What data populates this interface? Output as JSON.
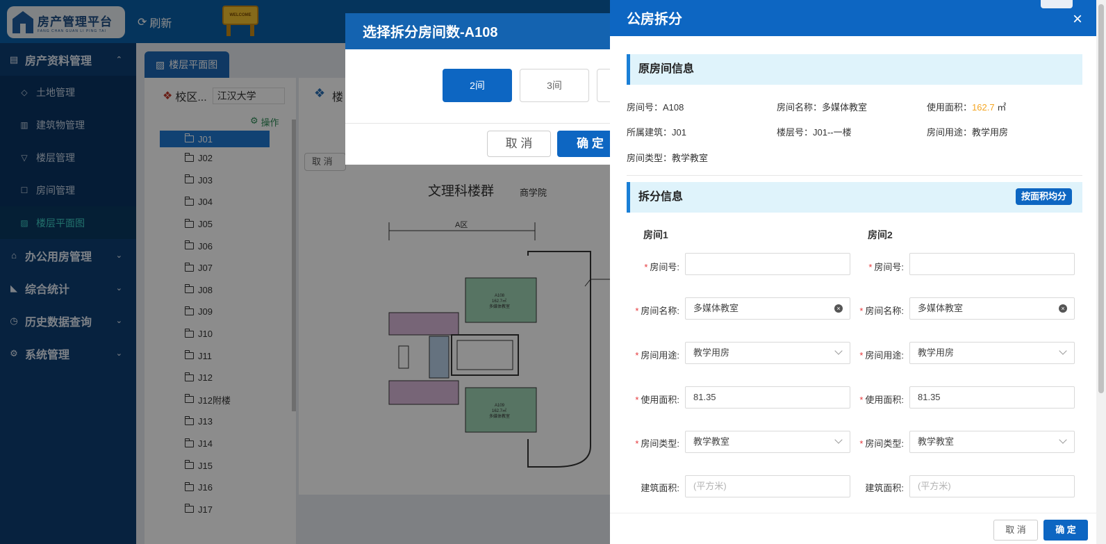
{
  "header": {
    "logo_title": "房产管理平台",
    "logo_subtitle": "FANG CHAN GUAN LI PING TAI",
    "refresh_label": "刷新",
    "welcome_sign": "WELCOME"
  },
  "sidebar": {
    "groups": [
      {
        "label": "房产资料管理",
        "icon": "list-icon",
        "expanded": true
      },
      {
        "label": "办公用房管理",
        "icon": "bank-icon"
      },
      {
        "label": "综合统计",
        "icon": "chart-icon"
      },
      {
        "label": "历史数据查询",
        "icon": "history-icon"
      },
      {
        "label": "系统管理",
        "icon": "gear-icon"
      }
    ],
    "subitems": [
      {
        "label": "土地管理",
        "icon": "tag-icon"
      },
      {
        "label": "建筑物管理",
        "icon": "building-icon"
      },
      {
        "label": "楼层管理",
        "icon": "filter-icon"
      },
      {
        "label": "房间管理",
        "icon": "square-icon"
      },
      {
        "label": "楼层平面图",
        "icon": "image-icon",
        "active": true
      }
    ]
  },
  "main": {
    "tab_label": "楼层平面图",
    "campus_label": "校区...",
    "campus_value": "江汉大学",
    "operate_label": "操作",
    "tree_nodes": [
      "J01",
      "J02",
      "J03",
      "J04",
      "J05",
      "J06",
      "J07",
      "J08",
      "J09",
      "J10",
      "J11",
      "J12",
      "J12附楼",
      "J13",
      "J14",
      "J15",
      "J16",
      "J17"
    ],
    "plan_toolbar_text": "楼",
    "plan_cancel": "取 消",
    "plan_title": "文理科楼群",
    "plan_subtitle": "商学院",
    "plan_zone": "A区",
    "room_a108": {
      "code": "A108",
      "area": "162.7㎡",
      "name": "多媒体教室"
    },
    "room_a109": {
      "code": "A109",
      "area": "162.7㎡",
      "name": "多媒体教室"
    }
  },
  "choose_dialog": {
    "title": "选择拆分房间数-A108",
    "options": [
      "2间",
      "3间"
    ],
    "selected": "2间",
    "cancel_label": "取 消",
    "confirm_label": "确 定"
  },
  "drawer": {
    "title": "公房拆分",
    "close_icon": "×",
    "original_section": "原房间信息",
    "original": {
      "room_no_label": "房间号：",
      "room_no": "A108",
      "room_name_label": "房间名称：",
      "room_name": "多媒体教室",
      "area_label": "使用面积：",
      "area": "162.7",
      "area_unit": "㎡",
      "building_label": "所属建筑：",
      "building": "J01",
      "floor_label": "楼层号：",
      "floor": "J01--一楼",
      "usage_label": "房间用途：",
      "usage": "教学用房",
      "type_label": "房间类型：",
      "type": "教学教室"
    },
    "split_section": "拆分信息",
    "avg_button": "按面积均分",
    "rooms": [
      {
        "title": "房间1",
        "room_no": "",
        "room_name": "多媒体教室",
        "usage": "教学用房",
        "area": "81.35",
        "type": "教学教室",
        "build_area_placeholder": "(平方米)"
      },
      {
        "title": "房间2",
        "room_no": "",
        "room_name": "多媒体教室",
        "usage": "教学用房",
        "area": "81.35",
        "type": "教学教室",
        "build_area_placeholder": "(平方米)"
      }
    ],
    "labels": {
      "room_no": "房间号:",
      "room_name": "房间名称:",
      "usage": "房间用途:",
      "area": "使用面积:",
      "type": "房间类型:",
      "build_area": "建筑面积:"
    },
    "cancel_label": "取 消",
    "confirm_label": "确 定"
  }
}
